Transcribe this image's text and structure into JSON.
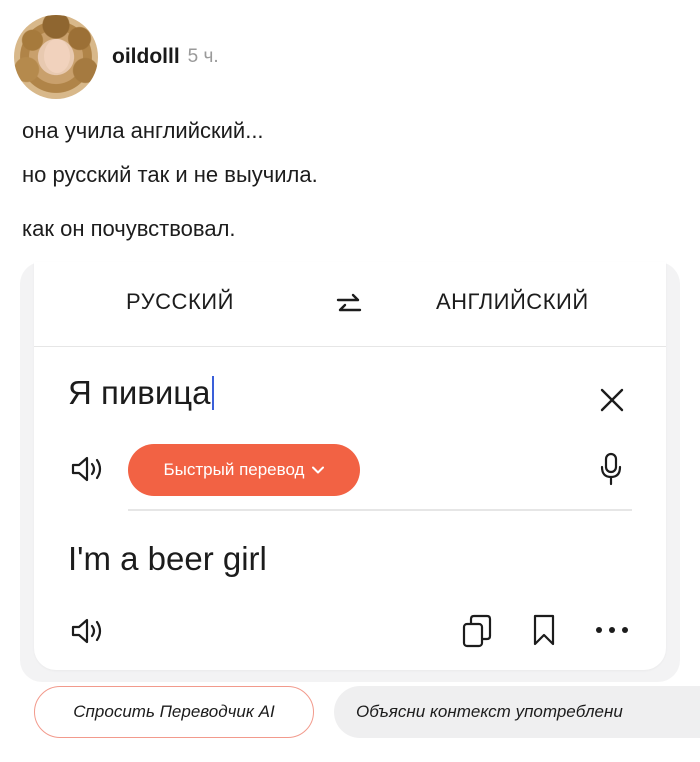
{
  "post": {
    "username": "oildolll",
    "time": "5 ч.",
    "lines": [
      "она учила английский...",
      "но русский так и не выучила.",
      "как он почувствовал."
    ]
  },
  "translator": {
    "source_lang": "РУССКИЙ",
    "target_lang": "АНГЛИЙСКИЙ",
    "source_text": "Я пивица",
    "quick_translate_label": "Быстрый перевод",
    "translated_text": "I'm a beer girl",
    "accent_color": "#f26244",
    "icons": [
      "swap-icon",
      "clear-icon",
      "speaker-icon",
      "chevron-down-icon",
      "mic-icon",
      "copy-icon",
      "bookmark-icon",
      "more-icon"
    ]
  },
  "chips": {
    "ask_ai": "Спросить Переводчик AI",
    "explain_context": "Объясни контекст употреблени"
  }
}
